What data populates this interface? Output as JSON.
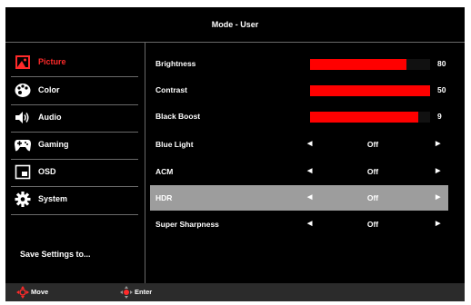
{
  "header": {
    "title": "Mode - User"
  },
  "sidebar": {
    "items": [
      {
        "label": "Picture",
        "icon": "picture-icon",
        "active": true
      },
      {
        "label": "Color",
        "icon": "palette-icon"
      },
      {
        "label": "Audio",
        "icon": "speaker-icon"
      },
      {
        "label": "Gaming",
        "icon": "gamepad-icon"
      },
      {
        "label": "OSD",
        "icon": "osd-window-icon"
      },
      {
        "label": "System",
        "icon": "gear-icon"
      }
    ],
    "save_label": "Save Settings to..."
  },
  "settings": [
    {
      "label": "Brightness",
      "type": "slider",
      "value": "80",
      "level": 0.8
    },
    {
      "label": "Contrast",
      "type": "slider",
      "value": "50",
      "level": 1.0
    },
    {
      "label": "Black Boost",
      "type": "slider",
      "value": "9",
      "level": 0.9
    },
    {
      "label": "Blue Light",
      "type": "option",
      "value": "Off"
    },
    {
      "label": "ACM",
      "type": "option",
      "value": "Off"
    },
    {
      "label": "HDR",
      "type": "option",
      "value": "Off",
      "selected": true
    },
    {
      "label": "Super Sharpness",
      "type": "option",
      "value": "Off"
    }
  ],
  "footer": {
    "move_label": "Move",
    "enter_label": "Enter"
  },
  "colors": {
    "accent": "#ff0000",
    "active_text": "#ff2a2a",
    "selected_row": "#9d9d9d",
    "background": "#000000"
  }
}
